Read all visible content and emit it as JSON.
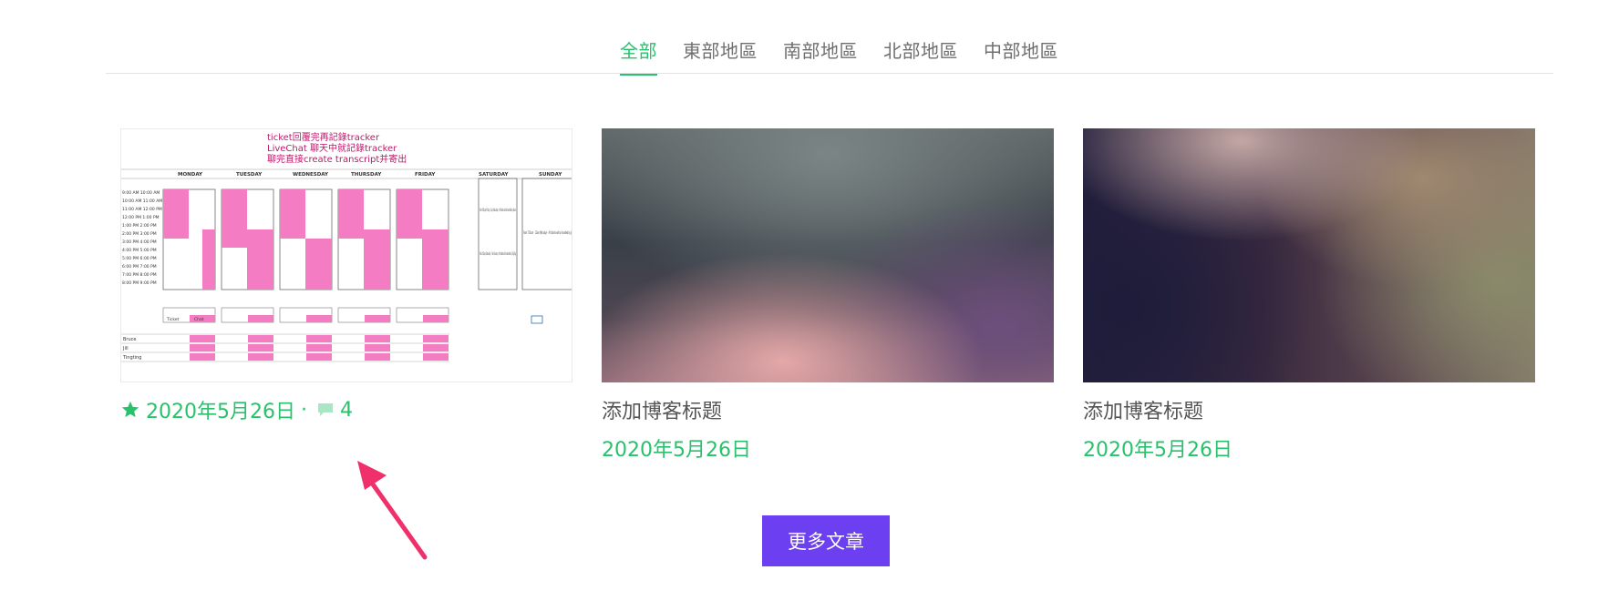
{
  "tabs": [
    {
      "label": "全部",
      "active": true
    },
    {
      "label": "東部地區",
      "active": false
    },
    {
      "label": "南部地區",
      "active": false
    },
    {
      "label": "北部地區",
      "active": false
    },
    {
      "label": "中部地區",
      "active": false
    }
  ],
  "posts": [
    {
      "title": "",
      "date": "2020年5月26日",
      "separator": "·",
      "comments": "4",
      "featured": true,
      "thumbnail": {
        "heading_lines": [
          "ticket回覆完再記錄tracker",
          "LiveChat 聊天中就記錄tracker",
          "聊完直接create transcript并寄出"
        ],
        "days": [
          "MONDAY",
          "TUESDAY",
          "WEDNESDAY",
          "THURSDAY",
          "FRIDAY",
          "SATURDAY",
          "SUNDAY"
        ],
        "times": [
          "9:00 AM  10:00 AM",
          "10:00 AM 11:00 AM",
          "11:00 AM 12:00 PM",
          "12:00 PM 1:00 PM",
          "1:00 PM  2:00 PM",
          "2:00 PM  3:00 PM",
          "3:00 PM  4:00 PM",
          "4:00 PM  5:00 PM",
          "5:00 PM  6:00 PM",
          "6:00 PM  7:00 PM",
          "7:00 PM  8:00 PM",
          "8:00 PM  9:00 PM"
        ],
        "saturday_note": "From 9:01pm (Friday) - 2pm (Saturday) - All tickets will be handled by Bruce",
        "saturday_note2": "From 2:01pm (Saturday) - 7am (Sunday) - All tickets will be handled by TingTing",
        "sunday_note": "From 7:01am - 12am (Monday) - All tickets will be handled by Jill",
        "sub_headers": [
          "Ticket",
          "Chat"
        ],
        "people": [
          "Bruce",
          "Jill",
          "Tingting"
        ]
      }
    },
    {
      "title": "添加博客标题",
      "date": "2020年5月26日"
    },
    {
      "title": "添加博客标题",
      "date": "2020年5月26日"
    }
  ],
  "more_button": "更多文章",
  "colors": {
    "accent_green": "#29c16c",
    "button_purple": "#6c3ff0",
    "arrow_pink": "#f0306a",
    "schedule_pink": "#f47cc2"
  }
}
